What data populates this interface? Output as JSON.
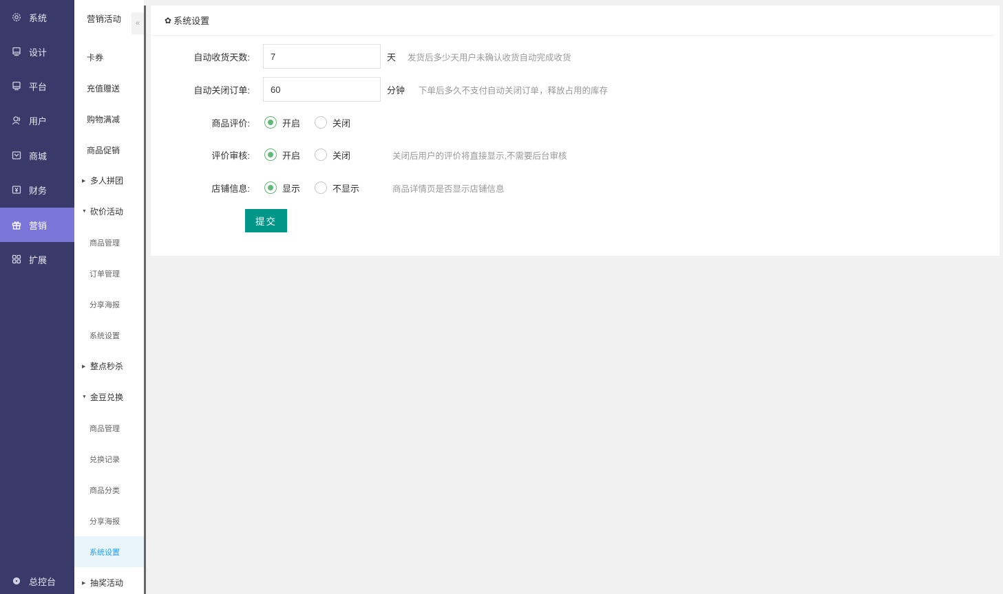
{
  "primary_nav": [
    {
      "label": "系统",
      "icon": "gear-icon"
    },
    {
      "label": "设计",
      "icon": "monitor-icon"
    },
    {
      "label": "平台",
      "icon": "monitor-icon"
    },
    {
      "label": "用户",
      "icon": "user-icon"
    },
    {
      "label": "商城",
      "icon": "shop-icon"
    },
    {
      "label": "财务",
      "icon": "finance-icon"
    },
    {
      "label": "营销",
      "icon": "gift-icon",
      "active": true
    },
    {
      "label": "扩展",
      "icon": "grid-icon"
    }
  ],
  "footer_nav": {
    "label": "总控台",
    "icon": "gear-icon"
  },
  "secondary_nav": {
    "title": "营销活动",
    "collapse_icon": "double-chevron-left-icon",
    "items": [
      {
        "label": "卡券",
        "type": "item"
      },
      {
        "label": "充值赠送",
        "type": "item"
      },
      {
        "label": "购物满减",
        "type": "item"
      },
      {
        "label": "商品促销",
        "type": "item"
      },
      {
        "label": "多人拼团",
        "type": "group",
        "expanded": false
      },
      {
        "label": "砍价活动",
        "type": "group",
        "expanded": true
      },
      {
        "label": "商品管理",
        "type": "sub"
      },
      {
        "label": "订单管理",
        "type": "sub"
      },
      {
        "label": "分享海报",
        "type": "sub"
      },
      {
        "label": "系统设置",
        "type": "sub"
      },
      {
        "label": "整点秒杀",
        "type": "group",
        "expanded": false
      },
      {
        "label": "金豆兑换",
        "type": "group",
        "expanded": true
      },
      {
        "label": "商品管理",
        "type": "sub"
      },
      {
        "label": "兑换记录",
        "type": "sub"
      },
      {
        "label": "商品分类",
        "type": "sub"
      },
      {
        "label": "分享海报",
        "type": "sub"
      },
      {
        "label": "系统设置",
        "type": "sub",
        "active": true
      },
      {
        "label": "抽奖活动",
        "type": "group",
        "expanded": false
      }
    ]
  },
  "panel": {
    "title": "系统设置",
    "icon": "gear-icon",
    "fields": {
      "auto_receive": {
        "label": "自动收货天数:",
        "value": "7",
        "unit": "天",
        "hint": "发货后多少天用户未确认收货自动完成收货"
      },
      "auto_close": {
        "label": "自动关闭订单:",
        "value": "60",
        "unit": "分钟",
        "hint": "下单后多久不支付自动关闭订单，释放占用的库存"
      },
      "review": {
        "label": "商品评价:",
        "options": [
          "开启",
          "关闭"
        ],
        "selected": "开启"
      },
      "review_audit": {
        "label": "评价审核:",
        "options": [
          "开启",
          "关闭"
        ],
        "selected": "开启",
        "hint": "关闭后用户的评价将直接显示,不需要后台审核"
      },
      "store_info": {
        "label": "店铺信息:",
        "options": [
          "显示",
          "不显示"
        ],
        "selected": "显示",
        "hint": "商品详情页是否显示店铺信息"
      }
    },
    "submit_label": "提交"
  },
  "colors": {
    "nav_bg": "#3a3a6a",
    "nav_active": "#7a77d8",
    "submit": "#009688",
    "radio_on": "#5fb878",
    "sub_active": "#1e9fff"
  }
}
